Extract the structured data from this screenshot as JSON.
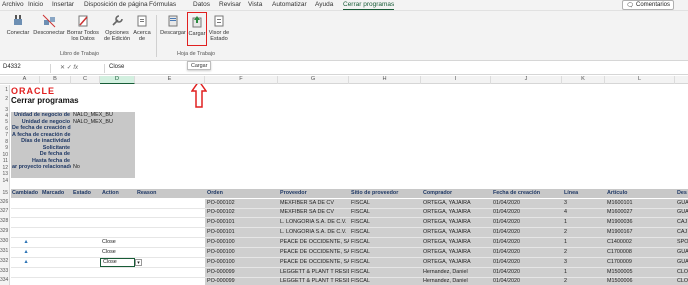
{
  "menu_tabs": [
    "Archivo",
    "Inicio",
    "Insertar",
    "Disposición de página",
    "Fórmulas",
    "Datos",
    "Revisar",
    "Vista",
    "Automatizar",
    "Ayuda",
    "Cerrar programas"
  ],
  "comments_label": "Comentarios",
  "ribbon": {
    "conectar": "Conectar",
    "desconectar": "Desconectar",
    "borrar_1": "Borrar Todos",
    "borrar_2": "los Datos",
    "opciones_1": "Opciones",
    "opciones_2": "de Edición",
    "acerca_1": "Acerca",
    "acerca_2": "de",
    "libro_label": "Libro de Trabajo",
    "descargar": "Descargar",
    "cargar": "Cargar",
    "visor_1": "Visor de",
    "visor_2": "Estado",
    "hoja_label": "Hoja de Trabajo",
    "tooltip": "Cargar"
  },
  "formula_bar": {
    "name_box": "D4332",
    "fx": "fx",
    "content": "Close"
  },
  "columns": [
    "A",
    "B",
    "C",
    "D",
    "E",
    "F",
    "G",
    "H",
    "I",
    "J",
    "K",
    "L"
  ],
  "sheet": {
    "logo": "ORACLE",
    "title": "Cerrar programas",
    "param_labels": [
      "Unidad de negocio de",
      "Unidad de negocio",
      "De fecha de creación de",
      "A fecha de creación de",
      "Días de inactividad",
      "Solicitante",
      "De fecha de",
      "Hasta fecha de",
      "ar proyecto relacionado"
    ],
    "param_values": [
      "NALO_MEX_BU",
      "NALO_MEX_BU",
      "",
      "",
      "",
      "",
      "",
      "",
      "No"
    ],
    "top_rows": [
      "1",
      "2",
      "3",
      "4",
      "5",
      "6",
      "7",
      "8",
      "9",
      "10",
      "11",
      "12",
      "13",
      "14",
      "15"
    ],
    "headers_left": [
      "Cambiado",
      "Marcado",
      "Estado",
      "Action",
      "Reason"
    ],
    "headers_right": [
      "Orden",
      "Proveedor",
      "Sitio de proveedor",
      "Comprador",
      "Fecha de creación",
      "Línea",
      "Artículo",
      "Des"
    ],
    "rows": [
      {
        "num": "326",
        "chg": "",
        "action": "",
        "orden": "PO-000102",
        "prov": "MEXFIBER SA DE CV",
        "sitio": "FISCAL",
        "comp": "ORTEGA, YAJAIRA",
        "fecha": "01/04/2020",
        "linea": "3",
        "art": "M1600101",
        "des": "GUA"
      },
      {
        "num": "327",
        "chg": "",
        "action": "",
        "orden": "PO-000102",
        "prov": "MEXFIBER SA DE CV",
        "sitio": "FISCAL",
        "comp": "ORTEGA, YAJAIRA",
        "fecha": "01/04/2020",
        "linea": "4",
        "art": "M1600027",
        "des": "GUA"
      },
      {
        "num": "328",
        "chg": "",
        "action": "",
        "orden": "PO-000101",
        "prov": "L. LONGORIA S.A. DE C.V.",
        "sitio": "FISCAL",
        "comp": "ORTEGA, YAJAIRA",
        "fecha": "01/04/2020",
        "linea": "1",
        "art": "M1900036",
        "des": "CAJ"
      },
      {
        "num": "329",
        "chg": "",
        "action": "",
        "orden": "PO-000101",
        "prov": "L. LONGORIA S.A. DE C.V.",
        "sitio": "FISCAL",
        "comp": "ORTEGA, YAJAIRA",
        "fecha": "01/04/2020",
        "linea": "2",
        "art": "M1900167",
        "des": "CAJ"
      },
      {
        "num": "330",
        "chg": "▲",
        "action": "Close",
        "orden": "PO-000100",
        "prov": "PEACE DE OCCIDENTE, SA DE",
        "sitio": "FISCAL",
        "comp": "ORTEGA, YAJAIRA",
        "fecha": "01/04/2020",
        "linea": "1",
        "art": "C1400002",
        "des": "SPO"
      },
      {
        "num": "331",
        "chg": "▲",
        "action": "Close",
        "orden": "PO-000100",
        "prov": "PEACE DE OCCIDENTE, SA DE",
        "sitio": "FISCAL",
        "comp": "ORTEGA, YAJAIRA",
        "fecha": "01/04/2020",
        "linea": "2",
        "art": "C1700008",
        "des": "GUA"
      },
      {
        "num": "332",
        "chg": "▲",
        "action": "Close",
        "orden": "PO-000100",
        "prov": "PEACE DE OCCIDENTE, SA DE",
        "sitio": "FISCAL",
        "comp": "ORTEGA, YAJAIRA",
        "fecha": "01/04/2020",
        "linea": "3",
        "art": "C1700009",
        "des": "GUA"
      },
      {
        "num": "333",
        "chg": "",
        "action": "",
        "orden": "PO-000099",
        "prov": "LEGGETT & PLANT T RESIDENC",
        "sitio": "FISCAL",
        "comp": "Hernandez, Daniel",
        "fecha": "01/04/2020",
        "linea": "1",
        "art": "M1500005",
        "des": "CLO"
      },
      {
        "num": "334",
        "chg": "",
        "action": "",
        "orden": "PO-000099",
        "prov": "LEGGETT & PLANT T RESIDENC",
        "sitio": "FISCAL",
        "comp": "Hernandez, Daniel",
        "fecha": "01/04/2020",
        "linea": "2",
        "art": "M1500006",
        "des": "CLO"
      }
    ]
  },
  "colors": {
    "accent": "#185c37",
    "highlight_box": "#e02020",
    "arrow": "#e02020",
    "header_text": "#1f3864"
  }
}
